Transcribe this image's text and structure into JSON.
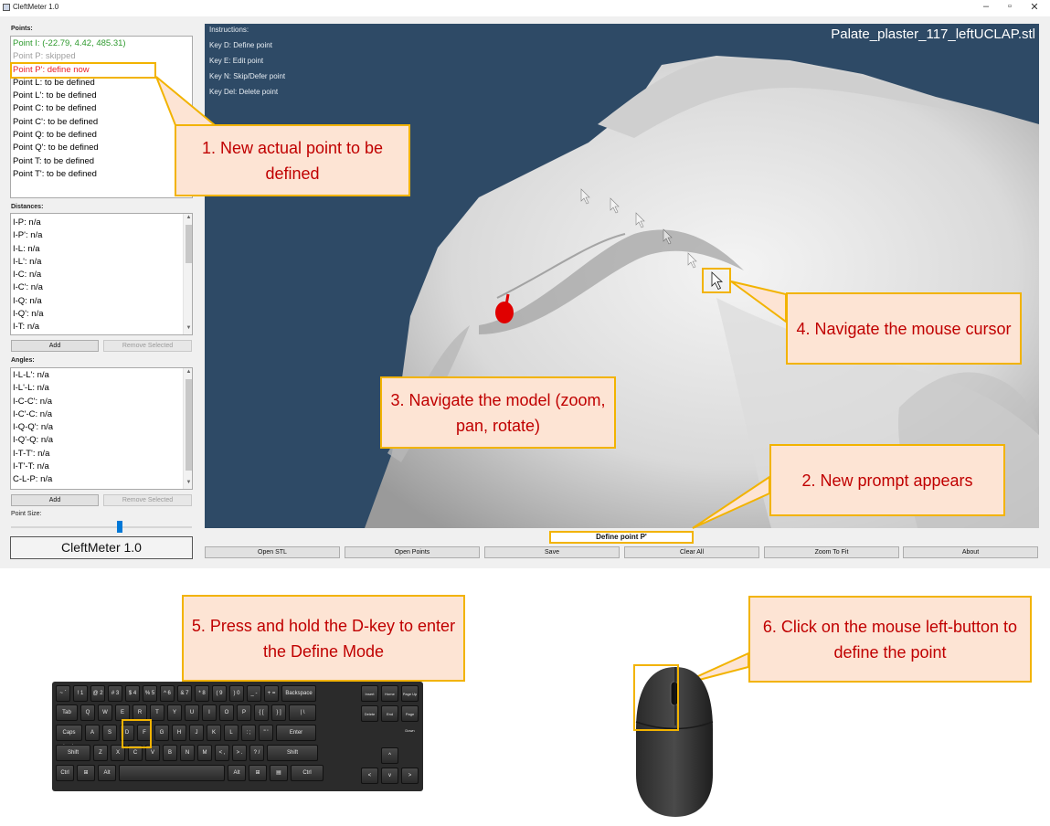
{
  "window": {
    "title": "CleftMeter 1.0",
    "controls": {
      "minimize": "–",
      "maximize": "▫",
      "close": "✕"
    }
  },
  "points": {
    "label": "Points:",
    "items": [
      {
        "text": "Point I: (-22.79, 4.42, 485.31)",
        "color": "#2e9a2e"
      },
      {
        "text": "Point P: skipped",
        "color": "#a0a0a0"
      },
      {
        "text": "Point P': define now",
        "color": "#e8202a"
      },
      {
        "text": "Point L: to be defined",
        "color": "#000000"
      },
      {
        "text": "Point L': to be defined",
        "color": "#000000"
      },
      {
        "text": "Point C: to be defined",
        "color": "#000000"
      },
      {
        "text": "Point C': to be defined",
        "color": "#000000"
      },
      {
        "text": "Point Q: to be defined",
        "color": "#000000"
      },
      {
        "text": "Point Q': to be defined",
        "color": "#000000"
      },
      {
        "text": "Point T: to be defined",
        "color": "#000000"
      },
      {
        "text": "Point T': to be defined",
        "color": "#000000"
      }
    ]
  },
  "distances": {
    "label": "Distances:",
    "items": [
      "I-P: n/a",
      "I-P': n/a",
      "I-L: n/a",
      "I-L': n/a",
      "I-C: n/a",
      "I-C': n/a",
      "I-Q: n/a",
      "I-Q': n/a",
      "I-T: n/a"
    ],
    "add": "Add",
    "remove": "Remove Selected"
  },
  "angles": {
    "label": "Angles:",
    "items": [
      "I-L-L': n/a",
      "I-L'-L: n/a",
      "I-C-C': n/a",
      "I-C'-C: n/a",
      "I-Q-Q': n/a",
      "I-Q'-Q: n/a",
      "I-T-T': n/a",
      "I-T'-T: n/a",
      "C-L-P: n/a"
    ],
    "add": "Add",
    "remove": "Remove Selected"
  },
  "point_size": {
    "label": "Point Size:",
    "value_fraction": 0.59
  },
  "brand": "CleftMeter 1.0",
  "viewport": {
    "instructions": [
      "Instructions:",
      "Key D: Define point",
      "Key E: Edit point",
      "Key N: Skip/Defer point",
      "Key Del: Delete point"
    ],
    "filename": "Palate_plaster_117_leftUCLAP.stl"
  },
  "prompt": "Define point P'",
  "bottom_buttons": [
    "Open STL",
    "Open Points",
    "Save",
    "Clear All",
    "Zoom To Fit",
    "About"
  ],
  "callouts": {
    "c1": "1. New actual point to be defined",
    "c2": "2. New prompt appears",
    "c3": "3. Navigate the model (zoom, pan, rotate)",
    "c4": "4. Navigate the mouse cursor",
    "c5": "5. Press and hold the D-key to enter the Define Mode",
    "c6": "6. Click on the mouse left-button to define the point"
  },
  "keyboard": {
    "row1": [
      "~ `",
      "! 1",
      "@ 2",
      "# 3",
      "$ 4",
      "% 5",
      "^ 6",
      "& 7",
      "* 8",
      "( 9",
      ") 0",
      "_ -",
      "+ =",
      "Backspace"
    ],
    "row2": [
      "Tab",
      "Q",
      "W",
      "E",
      "R",
      "T",
      "Y",
      "U",
      "I",
      "O",
      "P",
      "{ [",
      "} ]",
      "| \\"
    ],
    "row3": [
      "Caps Lock",
      "A",
      "S",
      "D",
      "F",
      "G",
      "H",
      "J",
      "K",
      "L",
      ": ;",
      "\" '",
      "Enter"
    ],
    "row4": [
      "Shift",
      "Z",
      "X",
      "C",
      "V",
      "B",
      "N",
      "M",
      "< ,",
      "> .",
      "? /",
      "Shift"
    ],
    "row5": [
      "Ctrl",
      "⊞",
      "Alt",
      "",
      "Alt",
      "⊞",
      "▤",
      "Ctrl"
    ],
    "nav": [
      "Insert",
      "Home",
      "Page Up",
      "Delete",
      "End",
      "Page Down"
    ],
    "arrows": [
      "^",
      "<",
      "v",
      ">"
    ]
  },
  "colors": {
    "accent": "#f2b300",
    "callout_bg": "#fde4d4",
    "callout_text": "#c00000",
    "viewport_bg": "#2e4a66",
    "marker": "#e00000"
  }
}
